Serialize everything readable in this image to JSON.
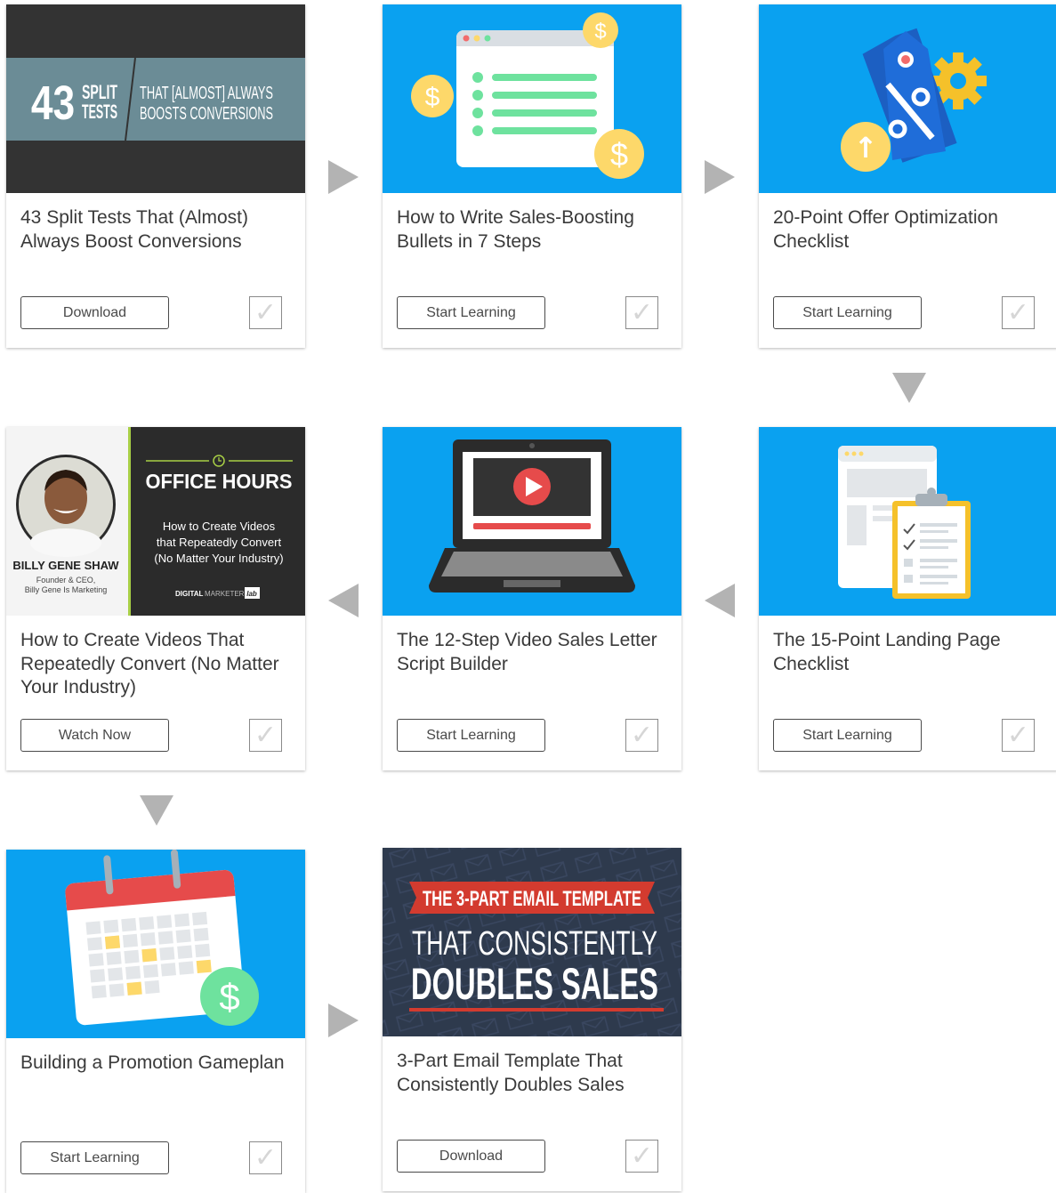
{
  "cards": [
    {
      "title": "43 Split Tests That (Almost) Always Boost Conversions",
      "button": "Download",
      "check": "✓",
      "thumb": {
        "number": "43",
        "split": "SPLIT",
        "tests": "TESTS",
        "line1": "THAT [ALMOST] ALWAYS",
        "line2": "BOOSTS CONVERSIONS"
      }
    },
    {
      "title": "How to Write Sales-Boosting Bullets in 7 Steps",
      "button": "Start Learning",
      "check": "✓",
      "thumb": {
        "dollar": "$"
      }
    },
    {
      "title": "20-Point Offer Optimization Checklist",
      "button": "Start Learning",
      "check": "✓",
      "thumb": {
        "up_arrow": "↑"
      }
    },
    {
      "title": "The 15-Point Landing Page Checklist",
      "button": "Start Learning",
      "check": "✓",
      "thumb": {}
    },
    {
      "title": "The 12-Step Video Sales Letter Script Builder",
      "button": "Start Learning",
      "check": "✓",
      "thumb": {}
    },
    {
      "title": "How to Create Videos That Repeatedly Convert (No Matter Your Industry)",
      "button": "Watch Now",
      "check": "✓",
      "thumb": {
        "name": "BILLY GENE SHAW",
        "role1": "Founder & CEO,",
        "role2": "Billy Gene Is Marketing",
        "heading": "OFFICE HOURS",
        "sub1": "How to Create Videos",
        "sub2": "that Repeatedly Convert",
        "sub3": "(No Matter Your Industry)",
        "brand_bold": "DIGITAL",
        "brand_light": "MARKETER",
        "brand_tag": "lab"
      }
    },
    {
      "title": "Building a Promotion Gameplan",
      "button": "Start Learning",
      "check": "✓",
      "thumb": {
        "dollar": "$"
      }
    },
    {
      "title": "3-Part Email Template That Consistently Doubles Sales",
      "button": "Download",
      "check": "✓",
      "thumb": {
        "line1": "THE 3-PART EMAIL TEMPLATE",
        "line2": "THAT CONSISTENTLY",
        "line3": "DOUBLES SALES"
      }
    }
  ],
  "colors": {
    "thumb_blue": "#0aa1f0",
    "dark_gray": "#333333",
    "teal_slate": "#6b8c96",
    "arrow_gray": "#b3b3b3",
    "gold": "#fdd86a",
    "green": "#6ee29e",
    "red": "#e64b4b",
    "navy": "#2e3a4d",
    "email_red": "#d33b2f"
  }
}
